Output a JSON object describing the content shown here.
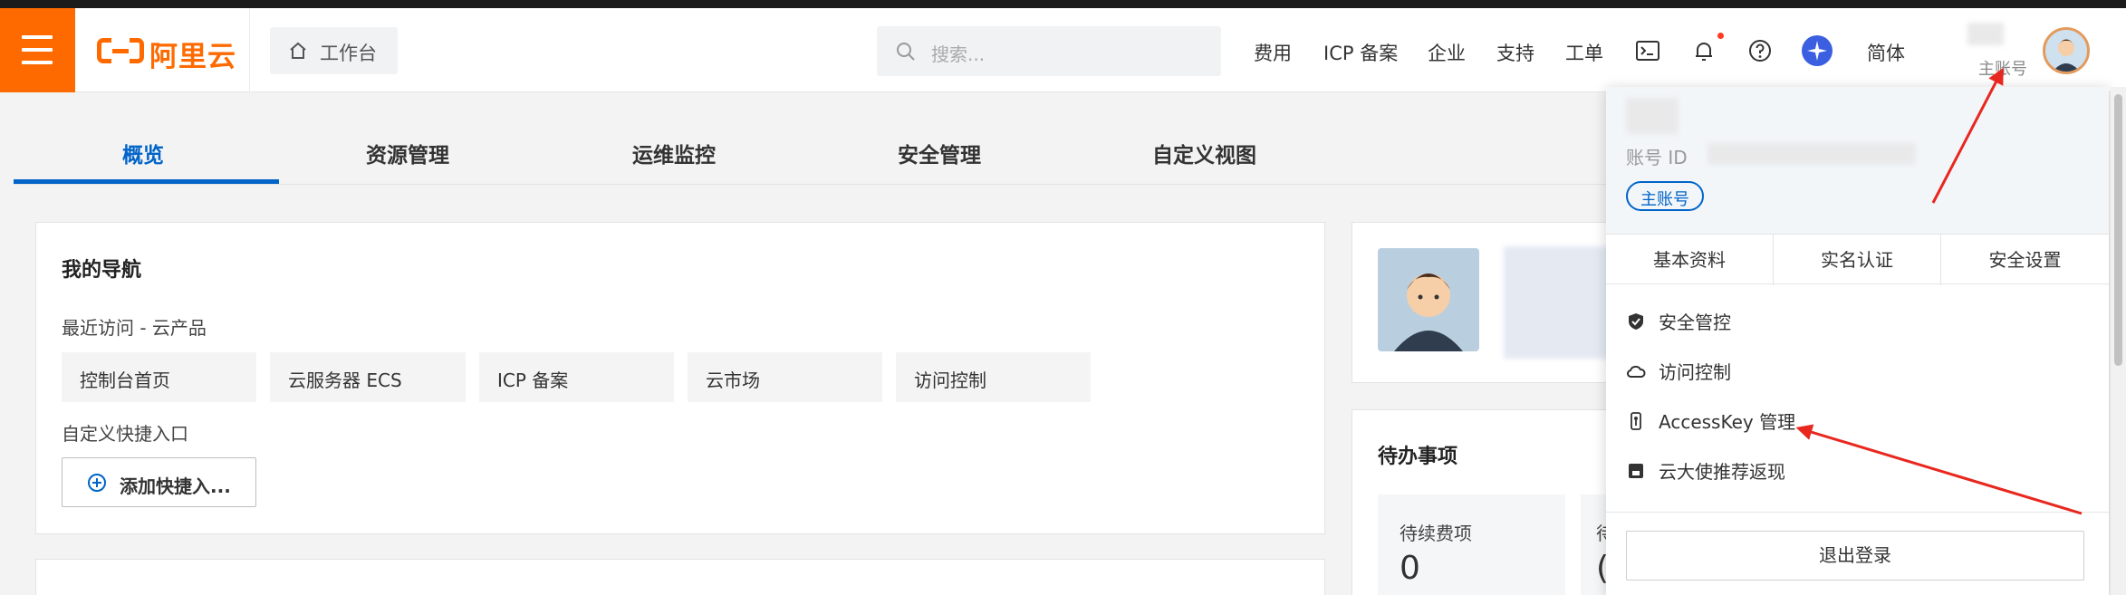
{
  "header": {
    "brand": "阿里云",
    "workbench_label": "工作台",
    "search_placeholder": "搜索...",
    "nav": [
      "费用",
      "ICP 备案",
      "企业",
      "支持",
      "工单"
    ],
    "lang": "简体",
    "account_type": "主账号"
  },
  "tabs": [
    "概览",
    "资源管理",
    "运维监控",
    "安全管理",
    "自定义视图"
  ],
  "navigation_card": {
    "title": "我的导航",
    "recent_label": "最近访问 - 云产品",
    "recent_items": [
      "控制台首页",
      "云服务器 ECS",
      "ICP 备案",
      "云市场",
      "访问控制"
    ],
    "custom_label": "自定义快捷入口",
    "add_button": "添加快捷入..."
  },
  "todo_card": {
    "title": "待办事项",
    "renewal_label": "待续费项",
    "renewal_count": "0",
    "second_label_partial": "待",
    "second_count_partial": "("
  },
  "account_menu": {
    "account_id_label": "账号 ID",
    "account_badge": "主账号",
    "tabs": [
      "基本资料",
      "实名认证",
      "安全设置"
    ],
    "items": [
      {
        "icon": "shield-icon",
        "label": "安全管控"
      },
      {
        "icon": "cloud-icon",
        "label": "访问控制"
      },
      {
        "icon": "key-icon",
        "label": "AccessKey 管理"
      },
      {
        "icon": "gift-icon",
        "label": "云大使推荐返现"
      }
    ],
    "logout": "退出登录"
  },
  "colors": {
    "brand_orange": "#ff6a00",
    "accent_blue": "#0064c8",
    "annotation_red": "#e8271e"
  }
}
